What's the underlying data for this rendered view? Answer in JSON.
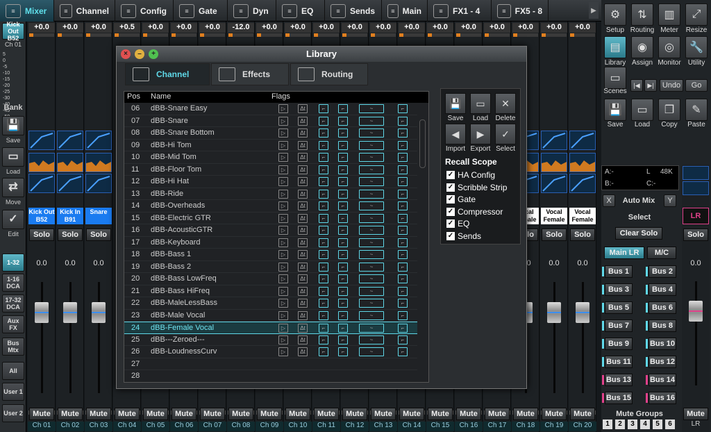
{
  "tabs": [
    {
      "label": "Mixer",
      "icon": "mixer-icon",
      "active": true
    },
    {
      "label": "Channel",
      "icon": "channel-icon"
    },
    {
      "label": "Config",
      "icon": "config-icon"
    },
    {
      "label": "Gate",
      "icon": "gate-icon"
    },
    {
      "label": "Dyn",
      "icon": "dyn-icon"
    },
    {
      "label": "EQ",
      "icon": "eq-icon"
    },
    {
      "label": "Sends",
      "icon": "sends-icon"
    },
    {
      "label": "Main",
      "icon": "main-icon"
    },
    {
      "label": "FX1 - 4",
      "icon": "fx-icon"
    },
    {
      "label": "FX5 - 8",
      "icon": "fx-icon"
    }
  ],
  "left": {
    "selected_name": "Kick Out B52",
    "ch": "Ch 01",
    "scale": [
      "5",
      "0",
      "-5",
      "-10",
      "-15",
      "-20",
      "-25",
      "-30",
      "-40",
      "-45",
      "-50"
    ],
    "bank": "Bank",
    "save": "Save",
    "load": "Load",
    "move": "Move",
    "edit": "Edit",
    "banks": [
      "1-32",
      "1-16 DCA",
      "17-32 DCA",
      "Aux FX",
      "Bus Mtx",
      "All",
      "User 1",
      "User 2"
    ]
  },
  "strips": [
    {
      "ch": "Ch 01",
      "gain": "+0.0",
      "name": "Kick Out B52",
      "blue": true,
      "fader": "0.0"
    },
    {
      "ch": "Ch 02",
      "gain": "+0.0",
      "name": "Kick In B91",
      "blue": true,
      "fader": "0.0"
    },
    {
      "ch": "Ch 03",
      "gain": "+0.0",
      "name": "Snare",
      "blue": true,
      "fader": "0.0"
    },
    {
      "ch": "Ch 04",
      "gain": "+0.5",
      "name": "",
      "fader": ""
    },
    {
      "ch": "Ch 05",
      "gain": "+0.0",
      "name": "",
      "fader": ""
    },
    {
      "ch": "Ch 06",
      "gain": "+0.0",
      "name": "",
      "fader": ""
    },
    {
      "ch": "Ch 07",
      "gain": "+0.0",
      "name": "",
      "fader": ""
    },
    {
      "ch": "Ch 08",
      "gain": "-12.0",
      "name": "",
      "fader": ""
    },
    {
      "ch": "Ch 09",
      "gain": "+0.0",
      "name": "",
      "fader": ""
    },
    {
      "ch": "Ch 10",
      "gain": "+0.0",
      "name": "",
      "fader": ""
    },
    {
      "ch": "Ch 11",
      "gain": "+0.0",
      "name": "",
      "fader": ""
    },
    {
      "ch": "Ch 12",
      "gain": "+0.0",
      "name": "",
      "fader": ""
    },
    {
      "ch": "Ch 13",
      "gain": "+0.0",
      "name": "",
      "fader": ""
    },
    {
      "ch": "Ch 14",
      "gain": "+0.0",
      "name": "",
      "fader": ""
    },
    {
      "ch": "Ch 15",
      "gain": "+0.0",
      "name": "",
      "fader": ""
    },
    {
      "ch": "Ch 16",
      "gain": "+0.0",
      "name": "",
      "fader": ""
    },
    {
      "ch": "Ch 17",
      "gain": "+0.0",
      "name": "",
      "fader": ""
    },
    {
      "ch": "Ch 18",
      "gain": "+0.0",
      "name": "Vocal Female",
      "fader": "0.0"
    },
    {
      "ch": "Ch 19",
      "gain": "+0.0",
      "name": "Vocal Female",
      "fader": "0.0"
    },
    {
      "ch": "Ch 20",
      "gain": "+0.0",
      "name": "Vocal Female",
      "fader": "0.0"
    }
  ],
  "solo_label": "Solo",
  "mute_label": "Mute",
  "library": {
    "title": "Library",
    "tabs": [
      "Channel",
      "Effects",
      "Routing"
    ],
    "columns": [
      "Pos",
      "Name",
      "Flags"
    ],
    "rows": [
      {
        "pos": "06",
        "name": "dBB-Snare Easy"
      },
      {
        "pos": "07",
        "name": "dBB-Snare"
      },
      {
        "pos": "08",
        "name": "dBB-Snare Bottom"
      },
      {
        "pos": "09",
        "name": "dBB-Hi Tom"
      },
      {
        "pos": "10",
        "name": "dBB-Mid Tom"
      },
      {
        "pos": "11",
        "name": "dBB-Floor Tom"
      },
      {
        "pos": "12",
        "name": "dBB-Hi Hat"
      },
      {
        "pos": "13",
        "name": "dBB-Ride"
      },
      {
        "pos": "14",
        "name": "dBB-Overheads"
      },
      {
        "pos": "15",
        "name": "dBB-Electric GTR"
      },
      {
        "pos": "16",
        "name": "dBB-AcousticGTR"
      },
      {
        "pos": "17",
        "name": "dBB-Keyboard"
      },
      {
        "pos": "18",
        "name": "dBB-Bass 1"
      },
      {
        "pos": "19",
        "name": "dBB-Bass 2"
      },
      {
        "pos": "20",
        "name": "dBB-Bass LowFreq"
      },
      {
        "pos": "21",
        "name": "dBB-Bass HiFreq"
      },
      {
        "pos": "22",
        "name": "dBB-MaleLessBass"
      },
      {
        "pos": "23",
        "name": "dBB-Male Vocal"
      },
      {
        "pos": "24",
        "name": "dBB-Female Vocal",
        "selected": true
      },
      {
        "pos": "25",
        "name": "dBB---Zeroed---"
      },
      {
        "pos": "26",
        "name": "dBB-LoudnessCurv"
      },
      {
        "pos": "27",
        "name": ""
      },
      {
        "pos": "28",
        "name": ""
      }
    ],
    "tools": {
      "save": "Save",
      "load": "Load",
      "delete": "Delete",
      "import": "Import",
      "export": "Export",
      "select": "Select"
    },
    "recall_title": "Recall Scope",
    "recall": [
      "HA Config",
      "Scribble Strip",
      "Gate",
      "Compressor",
      "EQ",
      "Sends"
    ]
  },
  "right": {
    "buttons": [
      "Setup",
      "Routing",
      "Meter",
      "Resize",
      "Library",
      "Assign",
      "Monitor",
      "Utility",
      "Scenes",
      "Save",
      "Load",
      "Copy",
      "Paste"
    ],
    "undo": "Undo",
    "go": "Go",
    "a": "A:-",
    "l": "L",
    "rate": "48K",
    "b": "B:-",
    "c": "C:-",
    "x": "X",
    "automix": "Auto Mix",
    "y": "Y",
    "select": "Select",
    "clear_solo": "Clear Solo",
    "main_lr": "Main LR",
    "mc": "M/C",
    "buses": [
      "Bus 1",
      "Bus 2",
      "Bus 3",
      "Bus 4",
      "Bus 5",
      "Bus 6",
      "Bus 7",
      "Bus 8",
      "Bus 9",
      "Bus 10",
      "Bus 11",
      "Bus 12",
      "Bus 13",
      "Bus 14",
      "Bus 15",
      "Bus 16"
    ],
    "mute_groups": "Mute Groups",
    "groups": [
      "1",
      "2",
      "3",
      "4",
      "5",
      "6"
    ],
    "lr_label": "LR",
    "lr_solo": "Solo",
    "lr_val": "0.0",
    "lr_mute": "Mute",
    "lr_ch": "LR"
  }
}
